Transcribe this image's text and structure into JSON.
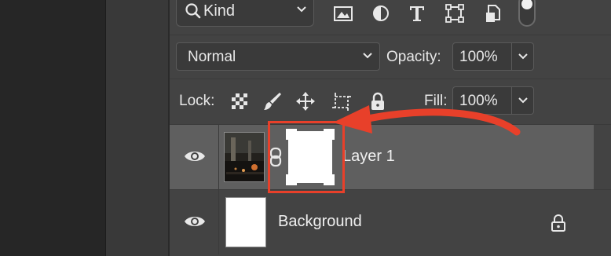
{
  "filter": {
    "kind_label": "Kind",
    "icons": [
      "image-filter-icon",
      "adjustment-filter-icon",
      "type-filter-icon",
      "shape-filter-icon",
      "smart-object-filter-icon"
    ]
  },
  "blend": {
    "mode": "Normal",
    "opacity_label": "Opacity:",
    "opacity_value": "100%"
  },
  "lock": {
    "label": "Lock:",
    "fill_label": "Fill:",
    "fill_value": "100%",
    "icons": [
      "lock-transparent-pixels-icon",
      "lock-image-pixels-icon",
      "lock-position-icon",
      "lock-artboard-icon",
      "lock-all-icon"
    ]
  },
  "layers": [
    {
      "name": "Layer 1",
      "selected": true,
      "has_mask": true,
      "locked": false
    },
    {
      "name": "Background",
      "selected": false,
      "has_mask": false,
      "locked": true
    }
  ],
  "annotation": {
    "color": "#e8402a"
  }
}
